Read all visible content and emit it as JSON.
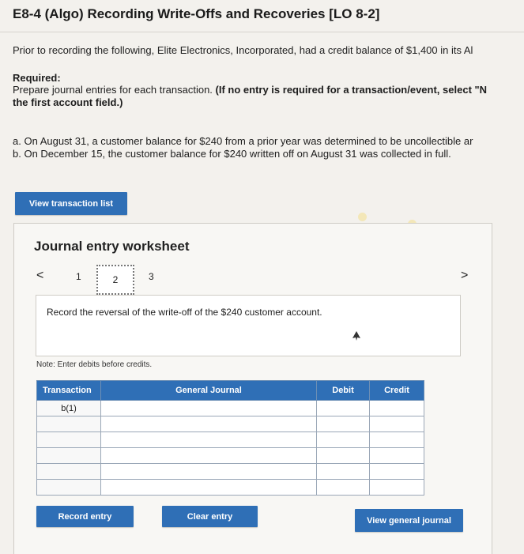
{
  "header": {
    "title": "E8-4 (Algo) Recording Write-Offs and Recoveries [LO 8-2]"
  },
  "intro": "Prior to recording the following, Elite Electronics, Incorporated, had a credit balance of $1,400 in its Al",
  "required": {
    "label": "Required:",
    "line1": "Prepare journal entries for each transaction. ",
    "line1_bold": "(If no entry is required for a transaction/event, select \"N",
    "line2_bold": "the first account field.)"
  },
  "transactions": [
    "a. On August 31, a customer balance for $240 from a prior year was determined to be uncollectible ar",
    "b. On December 15, the customer balance for $240 written off on August 31 was collected in full."
  ],
  "buttons": {
    "view_transaction_list": "View transaction list",
    "record_entry": "Record entry",
    "clear_entry": "Clear entry",
    "view_general_journal": "View general journal"
  },
  "worksheet": {
    "title": "Journal entry worksheet",
    "prev": "<",
    "next": ">",
    "pages": [
      "1",
      "2",
      "3"
    ],
    "current_page": "2",
    "instruction": "Record the reversal of the write-off of the $240 customer account.",
    "note": "Note: Enter debits before credits."
  },
  "journal": {
    "headers": [
      "Transaction",
      "General Journal",
      "Debit",
      "Credit"
    ],
    "rows": [
      {
        "transaction": "b(1)"
      },
      {
        "transaction": ""
      },
      {
        "transaction": ""
      },
      {
        "transaction": ""
      },
      {
        "transaction": ""
      },
      {
        "transaction": ""
      }
    ]
  },
  "colors": {
    "accent": "#2f6fb6",
    "background": "#f3f1ed"
  }
}
